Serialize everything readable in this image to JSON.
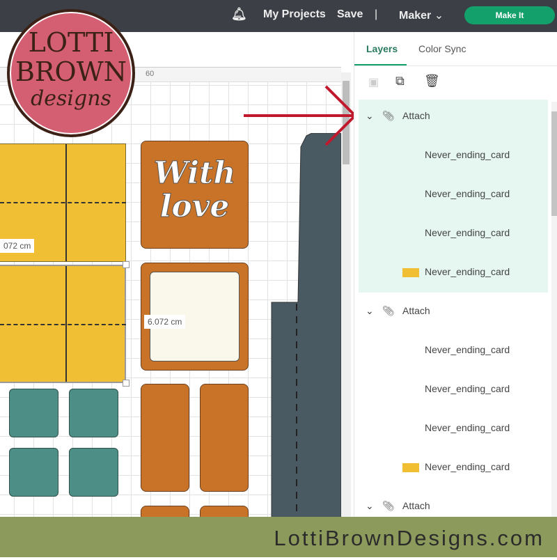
{
  "header": {
    "notifications_icon": "bell-icon",
    "my_projects": "My Projects",
    "save": "Save",
    "separator": "|",
    "machine": "Maker",
    "make_it": "Make It"
  },
  "canvas": {
    "ruler_label": "60",
    "dimension_1": "072 cm",
    "dimension_2": "6.072 cm",
    "card_text_1": "With",
    "card_text_2": "love"
  },
  "panel": {
    "tabs": [
      "Layers",
      "Color Sync"
    ],
    "active_tab": "Layers",
    "accent": "#13a06b",
    "groups": [
      {
        "label": "Attach",
        "children": [
          "Never_ending_card",
          "Never_ending_card",
          "Never_ending_card",
          "Never_ending_card"
        ]
      },
      {
        "label": "Attach",
        "children": [
          "Never_ending_card",
          "Never_ending_card",
          "Never_ending_card",
          "Never_ending_card"
        ]
      },
      {
        "label": "Attach",
        "children": []
      }
    ]
  },
  "logo": {
    "line1": "LOTTI",
    "line2": "BROWN",
    "line3": "designs"
  },
  "footer": {
    "text": "LottiBrownDesigns.com"
  }
}
